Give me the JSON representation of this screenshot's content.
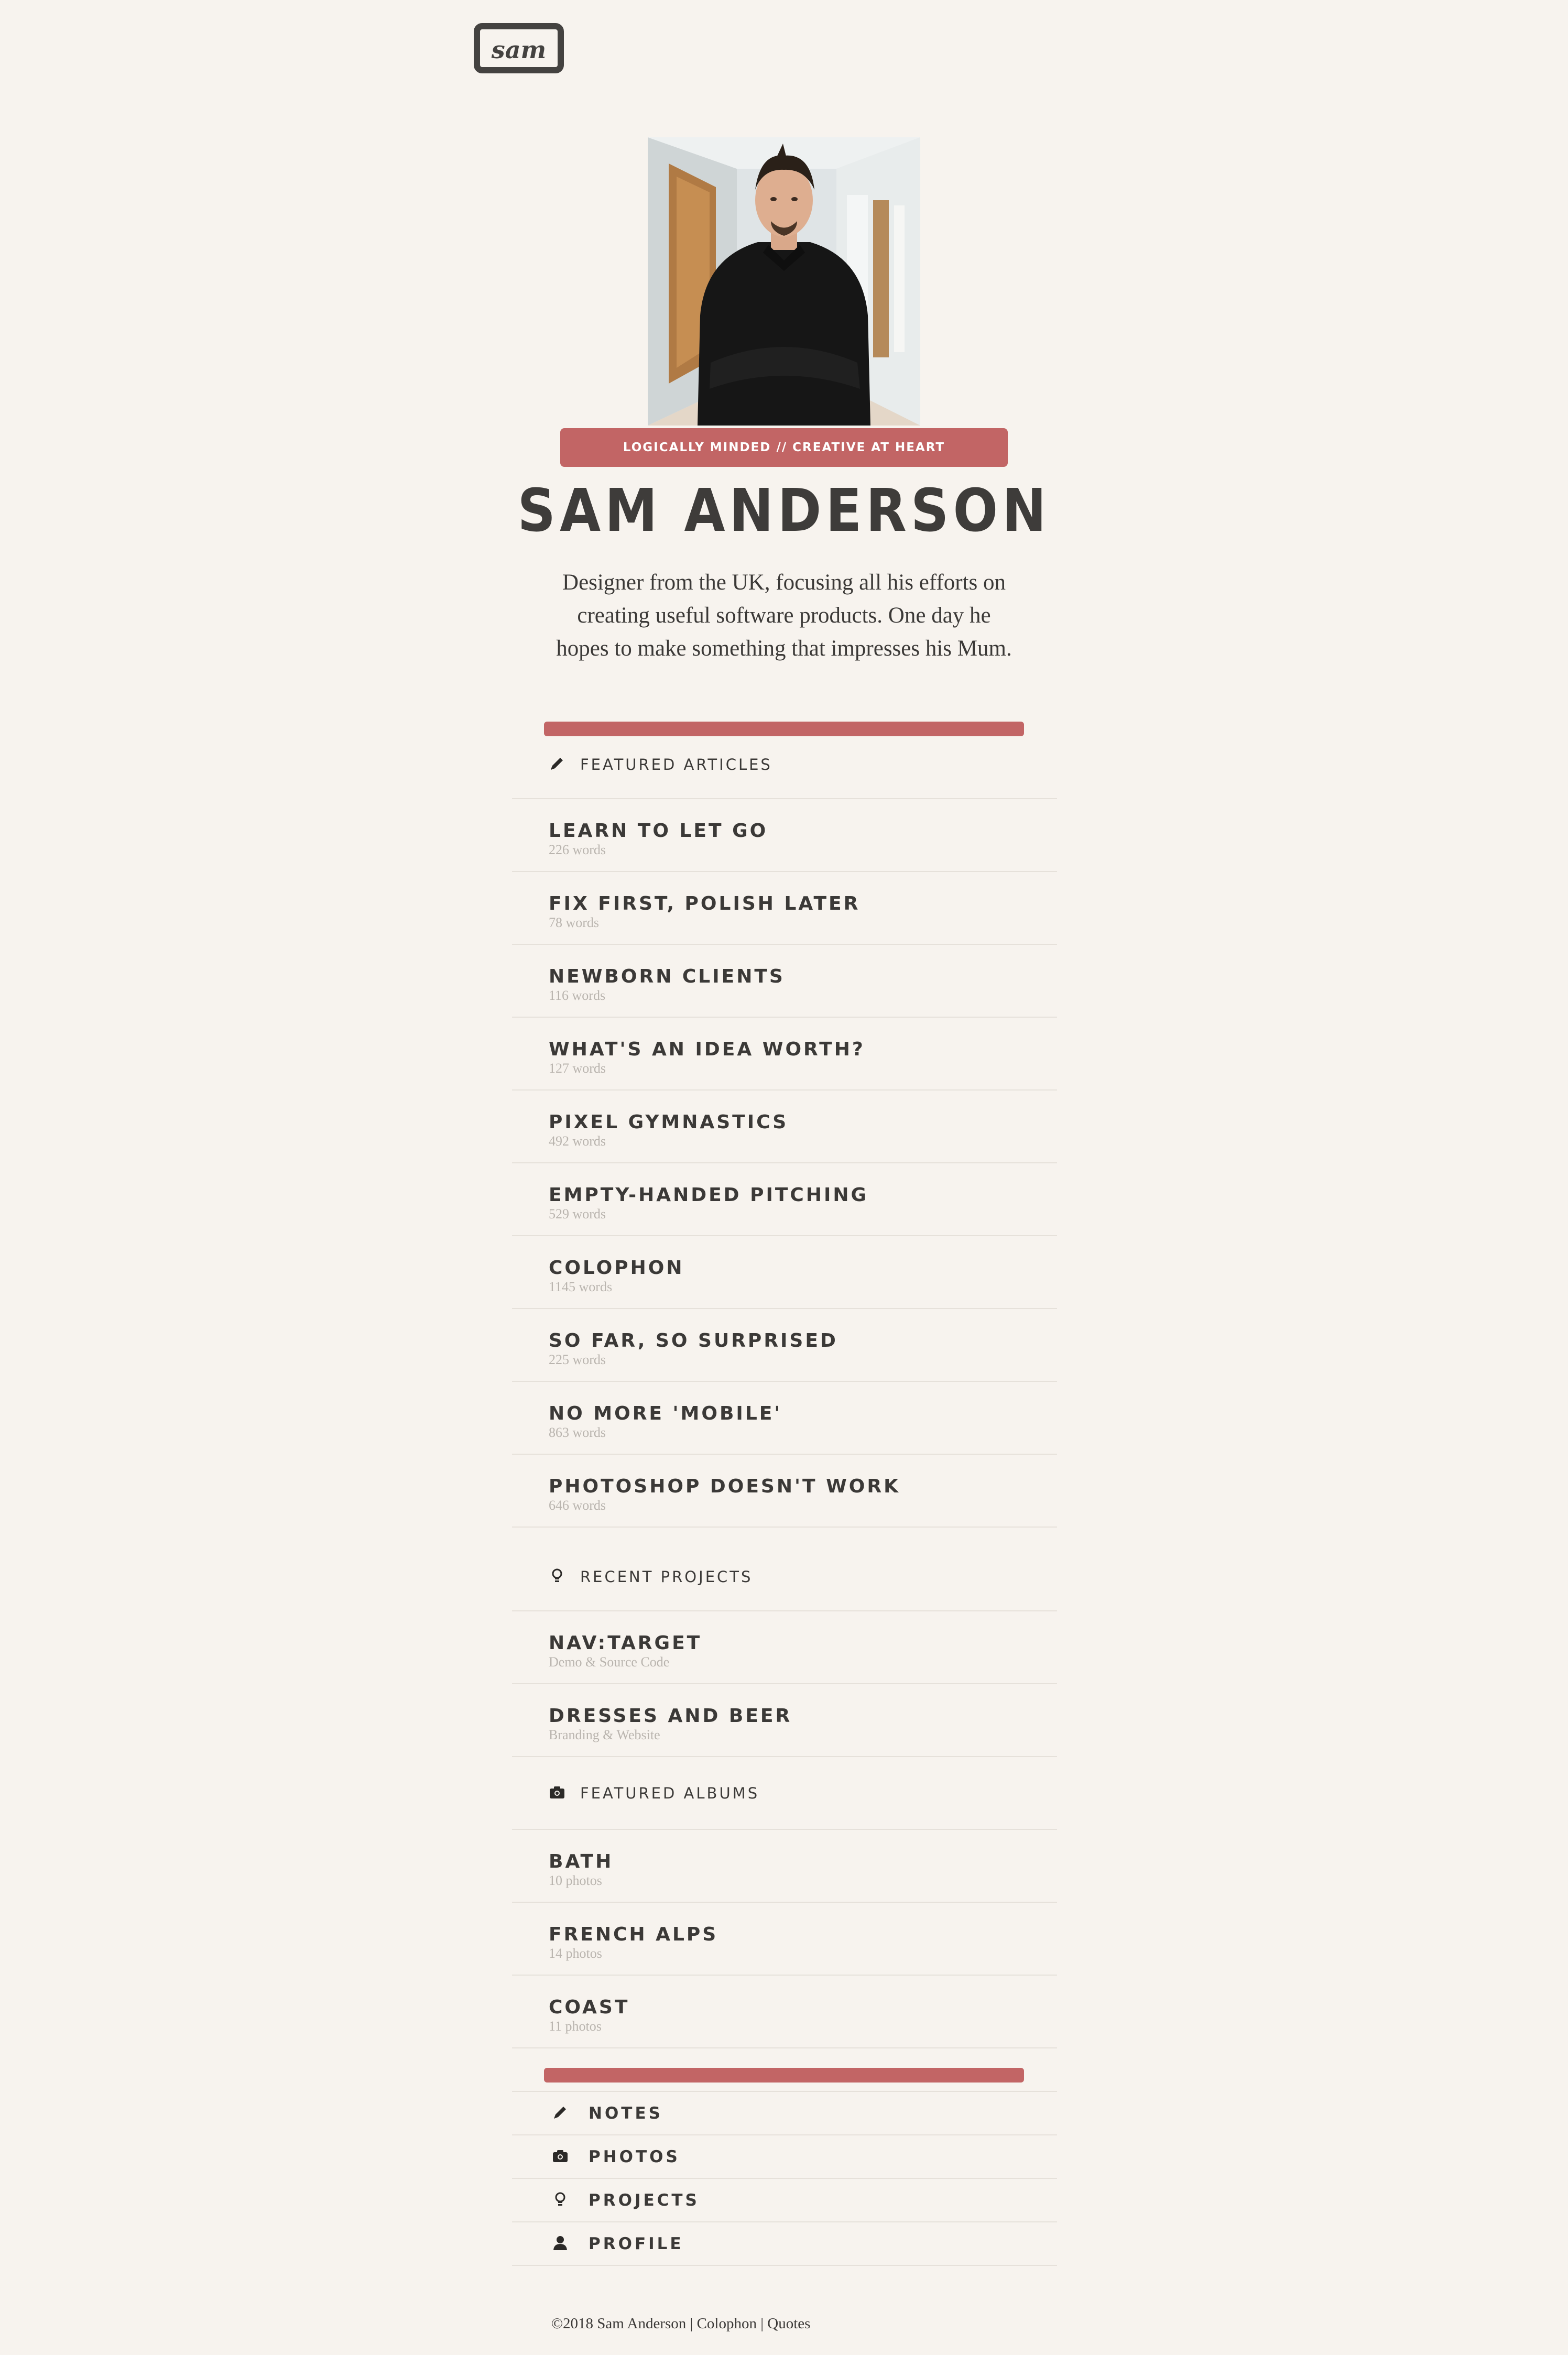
{
  "logo": {
    "text": "sam"
  },
  "hero": {
    "photo_alt": "Portrait of Sam Anderson",
    "tagline": "LOGICALLY MINDED // CREATIVE AT HEART",
    "name": "SAM ANDERSON",
    "bio": "Designer from the UK, focusing all his efforts on creating useful software products. One day he hopes to make something that impresses his Mum."
  },
  "articles": {
    "heading": "FEATURED ARTICLES",
    "icon": "pencil-icon",
    "items": [
      {
        "title": "LEARN TO LET GO",
        "meta": "226 words"
      },
      {
        "title": "FIX FIRST, POLISH LATER",
        "meta": "78 words"
      },
      {
        "title": "NEWBORN CLIENTS",
        "meta": "116 words"
      },
      {
        "title": "WHAT'S AN IDEA WORTH?",
        "meta": "127 words"
      },
      {
        "title": "PIXEL GYMNASTICS",
        "meta": "492 words"
      },
      {
        "title": "EMPTY-HANDED PITCHING",
        "meta": "529 words"
      },
      {
        "title": "COLOPHON",
        "meta": "1145 words"
      },
      {
        "title": "SO FAR, SO SURPRISED",
        "meta": "225 words"
      },
      {
        "title": "NO MORE 'MOBILE'",
        "meta": "863 words"
      },
      {
        "title": "PHOTOSHOP DOESN'T WORK",
        "meta": "646 words"
      }
    ]
  },
  "projects": {
    "heading": "RECENT PROJECTS",
    "icon": "lightbulb-icon",
    "items": [
      {
        "title": "NAV:TARGET",
        "meta": "Demo & Source Code"
      },
      {
        "title": "DRESSES AND BEER",
        "meta": "Branding & Website"
      }
    ]
  },
  "albums": {
    "heading": "FEATURED ALBUMS",
    "icon": "camera-icon",
    "items": [
      {
        "title": "BATH",
        "meta": "10 photos"
      },
      {
        "title": "FRENCH ALPS",
        "meta": "14 photos"
      },
      {
        "title": "COAST",
        "meta": "11 photos"
      }
    ]
  },
  "nav": [
    {
      "label": "NOTES",
      "icon": "pencil-icon"
    },
    {
      "label": "PHOTOS",
      "icon": "camera-icon"
    },
    {
      "label": "PROJECTS",
      "icon": "lightbulb-icon"
    },
    {
      "label": "PROFILE",
      "icon": "person-icon"
    }
  ],
  "footer": {
    "copyright": "©2018",
    "author": "Sam Anderson",
    "sep": "|",
    "colophon": "Colophon",
    "quotes": "Quotes"
  },
  "colors": {
    "accent": "#c26565",
    "background": "#f7f3ee",
    "text": "#3b3937",
    "meta": "#b9b4ae"
  }
}
